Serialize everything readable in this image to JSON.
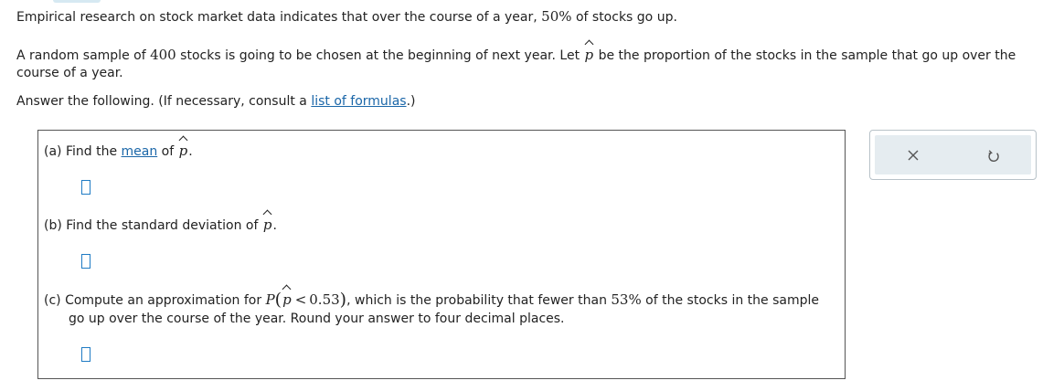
{
  "intro": {
    "line1": "Empirical research on stock market data indicates that over the course of a year, ",
    "line1_value": "50%",
    "line1_end": " of stocks go up.",
    "line2_a": "A random sample of ",
    "line2_n": "400",
    "line2_b": " stocks is going to be chosen at the beginning of next year. Let ",
    "line2_c": " be the proportion of the stocks in the sample that go up over the",
    "line3": "course of a year.",
    "line4_a": "Answer the following. (If necessary, consult a ",
    "line4_link": "list of formulas",
    "line4_b": ".)"
  },
  "phat_symbol": "p",
  "part_a": {
    "prefix": "(a) Find the ",
    "link": "mean",
    "suffix": " of ",
    "end": "."
  },
  "part_b": {
    "prefix": "(b) Find the standard deviation of ",
    "end": "."
  },
  "part_c": {
    "prefix": "(c) Compute an approximation for ",
    "P": "P",
    "lt": "<",
    "value": "0.53",
    "after": ", which is the probability that fewer than ",
    "percent": "53%",
    "after2": " of the stocks in the sample",
    "line2": "go up over the course of the year. Round your answer to four decimal places."
  },
  "answers": {
    "a": "",
    "b": "",
    "c": ""
  },
  "toolbar": {
    "clear_icon": "x-icon",
    "reset_icon": "undo-icon"
  }
}
